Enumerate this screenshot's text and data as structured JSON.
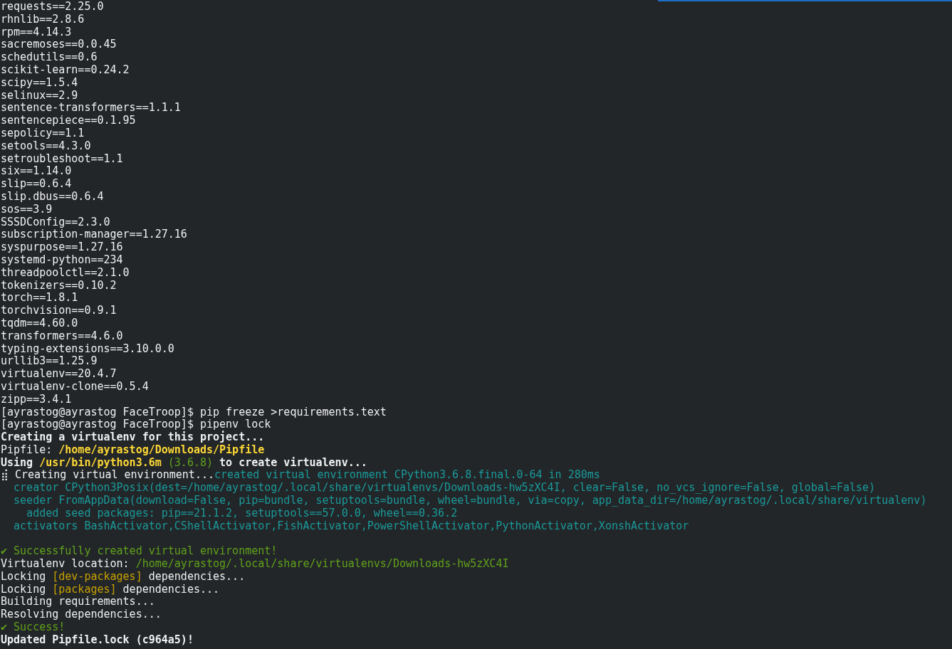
{
  "terminal": {
    "lines": [
      {
        "kind": "text",
        "segments": [
          {
            "text": "requests==2.25.0",
            "kind": "plain"
          }
        ]
      },
      {
        "kind": "text",
        "segments": [
          {
            "text": "rhnlib==2.8.6",
            "kind": "plain"
          }
        ]
      },
      {
        "kind": "text",
        "segments": [
          {
            "text": "rpm==4.14.3",
            "kind": "plain"
          }
        ]
      },
      {
        "kind": "text",
        "segments": [
          {
            "text": "sacremoses==0.0.45",
            "kind": "plain"
          }
        ]
      },
      {
        "kind": "text",
        "segments": [
          {
            "text": "schedutils==0.6",
            "kind": "plain"
          }
        ]
      },
      {
        "kind": "text",
        "segments": [
          {
            "text": "scikit-learn==0.24.2",
            "kind": "plain"
          }
        ]
      },
      {
        "kind": "text",
        "segments": [
          {
            "text": "scipy==1.5.4",
            "kind": "plain"
          }
        ]
      },
      {
        "kind": "text",
        "segments": [
          {
            "text": "selinux==2.9",
            "kind": "plain"
          }
        ]
      },
      {
        "kind": "text",
        "segments": [
          {
            "text": "sentence-transformers==1.1.1",
            "kind": "plain"
          }
        ]
      },
      {
        "kind": "text",
        "segments": [
          {
            "text": "sentencepiece==0.1.95",
            "kind": "plain"
          }
        ]
      },
      {
        "kind": "text",
        "segments": [
          {
            "text": "sepolicy==1.1",
            "kind": "plain"
          }
        ]
      },
      {
        "kind": "text",
        "segments": [
          {
            "text": "setools==4.3.0",
            "kind": "plain"
          }
        ]
      },
      {
        "kind": "text",
        "segments": [
          {
            "text": "setroubleshoot==1.1",
            "kind": "plain"
          }
        ]
      },
      {
        "kind": "text",
        "segments": [
          {
            "text": "six==1.14.0",
            "kind": "plain"
          }
        ]
      },
      {
        "kind": "text",
        "segments": [
          {
            "text": "slip==0.6.4",
            "kind": "plain"
          }
        ]
      },
      {
        "kind": "text",
        "segments": [
          {
            "text": "slip.dbus==0.6.4",
            "kind": "plain"
          }
        ]
      },
      {
        "kind": "text",
        "segments": [
          {
            "text": "sos==3.9",
            "kind": "plain"
          }
        ]
      },
      {
        "kind": "text",
        "segments": [
          {
            "text": "SSSDConfig==2.3.0",
            "kind": "plain"
          }
        ]
      },
      {
        "kind": "text",
        "segments": [
          {
            "text": "subscription-manager==1.27.16",
            "kind": "plain"
          }
        ]
      },
      {
        "kind": "text",
        "segments": [
          {
            "text": "syspurpose==1.27.16",
            "kind": "plain"
          }
        ]
      },
      {
        "kind": "text",
        "segments": [
          {
            "text": "systemd-python==234",
            "kind": "plain"
          }
        ]
      },
      {
        "kind": "text",
        "segments": [
          {
            "text": "threadpoolctl==2.1.0",
            "kind": "plain"
          }
        ]
      },
      {
        "kind": "text",
        "segments": [
          {
            "text": "tokenizers==0.10.2",
            "kind": "plain"
          }
        ]
      },
      {
        "kind": "text",
        "segments": [
          {
            "text": "torch==1.8.1",
            "kind": "plain"
          }
        ]
      },
      {
        "kind": "text",
        "segments": [
          {
            "text": "torchvision==0.9.1",
            "kind": "plain"
          }
        ]
      },
      {
        "kind": "text",
        "segments": [
          {
            "text": "tqdm==4.60.0",
            "kind": "plain"
          }
        ]
      },
      {
        "kind": "text",
        "segments": [
          {
            "text": "transformers==4.6.0",
            "kind": "plain"
          }
        ]
      },
      {
        "kind": "text",
        "segments": [
          {
            "text": "typing-extensions==3.10.0.0",
            "kind": "plain"
          }
        ]
      },
      {
        "kind": "text",
        "segments": [
          {
            "text": "urllib3==1.25.9",
            "kind": "plain"
          }
        ]
      },
      {
        "kind": "text",
        "segments": [
          {
            "text": "virtualenv==20.4.7",
            "kind": "plain"
          }
        ]
      },
      {
        "kind": "text",
        "segments": [
          {
            "text": "virtualenv-clone==0.5.4",
            "kind": "plain"
          }
        ]
      },
      {
        "kind": "text",
        "segments": [
          {
            "text": "zipp==3.4.1",
            "kind": "plain"
          }
        ]
      },
      {
        "kind": "text",
        "segments": [
          {
            "text": "[ayrastog@ayrastog FaceTroop]$ pip freeze >requirements.text",
            "kind": "plain"
          }
        ]
      },
      {
        "kind": "text",
        "segments": [
          {
            "text": "[ayrastog@ayrastog FaceTroop]$ pipenv lock",
            "kind": "plain"
          }
        ]
      },
      {
        "kind": "text",
        "segments": [
          {
            "text": "Creating a virtualenv for this project...",
            "kind": "bold"
          }
        ]
      },
      {
        "kind": "text",
        "segments": [
          {
            "text": "Pipfile: ",
            "kind": "plain"
          },
          {
            "text": "/home/ayrastog/Downloads/Pipfile",
            "kind": "path"
          }
        ]
      },
      {
        "kind": "text",
        "segments": [
          {
            "text": "Using ",
            "kind": "bold"
          },
          {
            "text": "/usr/bin/python3.6m",
            "kind": "path"
          },
          {
            "text": " (3.6.8)",
            "kind": "green"
          },
          {
            "text": " to create virtualenv...",
            "kind": "bold"
          }
        ]
      },
      {
        "kind": "text",
        "segments": [
          {
            "text": "⣾ Creating virtual environment...",
            "kind": "plain"
          },
          {
            "text": "created virtual environment CPython3.6.8.final.0-64 in 280ms",
            "kind": "teal"
          }
        ]
      },
      {
        "kind": "text",
        "segments": [
          {
            "text": "  creator CPython3Posix(dest=/home/ayrastog/.local/share/virtualenvs/Downloads-hw5zXC4I, clear=False, no_vcs_ignore=False, global=False)",
            "kind": "teal"
          }
        ]
      },
      {
        "kind": "text",
        "segments": [
          {
            "text": "  seeder FromAppData(download=False, pip=bundle, setuptools=bundle, wheel=bundle, via=copy, app_data_dir=/home/ayrastog/.local/share/virtualenv)",
            "kind": "teal"
          }
        ]
      },
      {
        "kind": "text",
        "segments": [
          {
            "text": "    added seed packages: pip==21.1.2, setuptools==57.0.0, wheel==0.36.2",
            "kind": "teal"
          }
        ]
      },
      {
        "kind": "text",
        "segments": [
          {
            "text": "  activators BashActivator,CShellActivator,FishActivator,PowerShellActivator,PythonActivator,XonshActivator",
            "kind": "teal"
          }
        ]
      },
      {
        "kind": "blank"
      },
      {
        "kind": "text",
        "segments": [
          {
            "text": "✔ Successfully created virtual environment!",
            "kind": "green"
          }
        ]
      },
      {
        "kind": "text",
        "segments": [
          {
            "text": "Virtualenv location: ",
            "kind": "plain"
          },
          {
            "text": "/home/ayrastog/.local/share/virtualenvs/Downloads-hw5zXC4I",
            "kind": "green"
          }
        ]
      },
      {
        "kind": "text",
        "segments": [
          {
            "text": "Locking ",
            "kind": "plain"
          },
          {
            "text": "[dev-packages]",
            "kind": "orange"
          },
          {
            "text": " dependencies...",
            "kind": "plain"
          }
        ]
      },
      {
        "kind": "text",
        "segments": [
          {
            "text": "Locking ",
            "kind": "plain"
          },
          {
            "text": "[packages]",
            "kind": "orange"
          },
          {
            "text": " dependencies...",
            "kind": "plain"
          }
        ]
      },
      {
        "kind": "text",
        "segments": [
          {
            "text": "Building requirements...",
            "kind": "plain"
          }
        ]
      },
      {
        "kind": "text",
        "segments": [
          {
            "text": "Resolving dependencies...",
            "kind": "plain"
          }
        ]
      },
      {
        "kind": "text",
        "segments": [
          {
            "text": "✔ Success!",
            "kind": "green"
          }
        ]
      },
      {
        "kind": "text",
        "segments": [
          {
            "text": "Updated Pipfile.lock (c964a5)!",
            "kind": "bold"
          }
        ]
      }
    ]
  }
}
